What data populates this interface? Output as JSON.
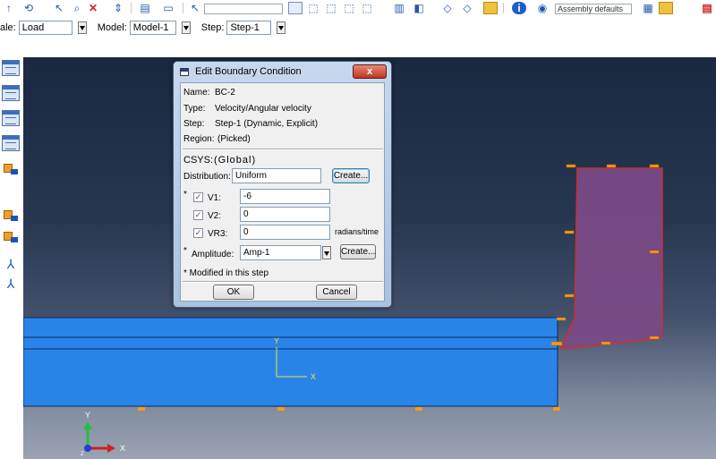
{
  "context_bar": {
    "module_label": "ale:",
    "module_value": "Load",
    "model_label": "Model:",
    "model_value": "Model-1",
    "step_label": "Step:",
    "step_value": "Step-1"
  },
  "toolbar": {
    "assembly_defaults": "Assembly defaults"
  },
  "dialog": {
    "title": "Edit Boundary Condition",
    "name_label": "Name:",
    "name_value": "BC-2",
    "type_label": "Type:",
    "type_value": "Velocity/Angular velocity",
    "step_label": "Step:",
    "step_value": "Step-1 (Dynamic, Explicit)",
    "region_label": "Region:",
    "region_value": "(Picked)",
    "csys_label": "CSYS:",
    "csys_value": "(Global)",
    "distribution_label": "Distribution:",
    "distribution_value": "Uniform",
    "create_button": "Create...",
    "components": [
      {
        "label": "V1:",
        "value": "-6",
        "checked": true,
        "modified": true,
        "unit": ""
      },
      {
        "label": "V2:",
        "value": "0",
        "checked": true,
        "modified": false,
        "unit": ""
      },
      {
        "label": "VR3:",
        "value": "0",
        "checked": true,
        "modified": false,
        "unit": "radians/time"
      }
    ],
    "amplitude_label": "Amplitude:",
    "amplitude_value": "Amp-1",
    "amplitude_create_button": "Create...",
    "footnote": "* Modified in this step",
    "ok_button": "OK",
    "cancel_button": "Cancel",
    "asterisk": "*",
    "close_glyph": "x"
  },
  "viewport": {
    "axis_y": "Y",
    "axis_x": "X",
    "triad_y": "Y",
    "triad_x": "X",
    "triad_z": "Z"
  },
  "colors": {
    "part_blue": "#2a84e8",
    "region_purple": "#7a4a86",
    "bc_marker": "#f59a1a"
  },
  "icons": [
    "viewport-table-icon",
    "load-manager-icon",
    "bc-manager-icon",
    "predefined-field-icon",
    "create-bc-icon",
    "create-load-icon",
    "datum-csys-icon",
    "csys-triad-icon"
  ]
}
